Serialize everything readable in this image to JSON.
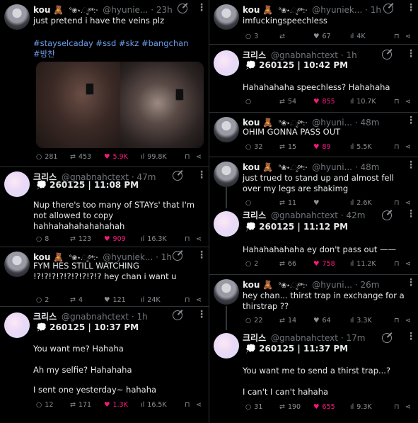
{
  "left_column": {
    "tweets": [
      {
        "author": {
          "name": "kou",
          "emoji": "🧸",
          "decoration": "°❀⋆.ೃ࿔*:･",
          "handle": "@hyunie...",
          "time": "· 23h"
        },
        "text": "just pretend i have the veins plz",
        "hashtags": "#stayselcaday #ssd #skz #bangchan #방찬",
        "stats": {
          "replies": "281",
          "reposts": "453",
          "likes": "5.9K",
          "views": "99.8K"
        }
      },
      {
        "author": {
          "name": "크리스",
          "handle": "@gnabnahctext",
          "time": "· 47m"
        },
        "stamp": "💭 260125 | 11:08 PM",
        "text": "Nup there's too many of STAYs' that I'm not allowed to copy hahhahahahahahahah",
        "stats": {
          "replies": "8",
          "reposts": "123",
          "likes": "909",
          "views": "16.3K"
        }
      },
      {
        "author": {
          "name": "kou",
          "emoji": "🧸",
          "decoration": "°❀⋆.ೃ࿔*:･",
          "handle": "@hyuniek...",
          "time": "· 1h"
        },
        "text": "FYM HES STILL WATCHING !?!?!?!?!?!?!?!?!? hey chan i want u",
        "stats": {
          "replies": "2",
          "reposts": "4",
          "likes": "121",
          "views": "24K"
        }
      },
      {
        "author": {
          "name": "크리스",
          "handle": "@gnabnahctext",
          "time": "· 1h"
        },
        "stamp": "💭 260125 | 10:37 PM",
        "lines": [
          "You want me? Hahaha",
          "Ah my selfie? Hahahaha",
          "I sent one yesterday~ hahaha"
        ],
        "stats": {
          "replies": "12",
          "reposts": "171",
          "likes": "1.3K",
          "views": "16.5K"
        }
      }
    ]
  },
  "right_column": {
    "tweets": [
      {
        "author": {
          "name": "kou",
          "emoji": "🧸",
          "decoration": "°❀⋆.ೃ࿔*:･",
          "handle": "@hyuniek...",
          "time": "· 1h"
        },
        "text": "imfuckingspeechless",
        "stats": {
          "replies": "3",
          "reposts": "",
          "likes": "67",
          "views": "4K"
        }
      },
      {
        "author": {
          "name": "크리스",
          "handle": "@gnabnahctext",
          "time": "· 1h"
        },
        "stamp": "💭 260125 | 10:42 PM",
        "text": "Hahahahaha speechless? Hahahaha",
        "stats": {
          "replies": "",
          "reposts": "54",
          "likes": "855",
          "views": "10.7K"
        }
      },
      {
        "author": {
          "name": "kou",
          "emoji": "🧸",
          "decoration": "°❀⋆.ೃ࿔*:･",
          "handle": "@hyuni...",
          "time": "· 48m"
        },
        "text": "OHIM GONNA PASS OUT",
        "stats": {
          "replies": "32",
          "reposts": "15",
          "likes": "89",
          "views": "5.5K"
        }
      },
      {
        "author": {
          "name": "kou",
          "emoji": "🧸",
          "decoration": "°❀⋆.ೃ࿔*:･",
          "handle": "@hyuni...",
          "time": "· 48m"
        },
        "text": "just trued to stand up and almost fell over my legs are shakimg",
        "stats": {
          "replies": "",
          "reposts": "11",
          "likes": "",
          "views": "2.6K"
        }
      },
      {
        "author": {
          "name": "크리스",
          "handle": "@gnabnahctext",
          "time": "· 42m"
        },
        "stamp": "💭 260125 | 11:12 PM",
        "text": "Hahahahahaha ey don't pass out ——",
        "stats": {
          "replies": "2",
          "reposts": "66",
          "likes": "758",
          "views": "11.2K"
        }
      },
      {
        "author": {
          "name": "kou",
          "emoji": "🧸",
          "decoration": "°❀⋆.ೃ࿔*:･",
          "handle": "@hyuni...",
          "time": "· 26m"
        },
        "text": "hey chan... thirst trap in exchange for a thirstrap ??",
        "stats": {
          "replies": "22",
          "reposts": "14",
          "likes": "64",
          "views": "3.3K"
        }
      },
      {
        "author": {
          "name": "크리스",
          "handle": "@gnabnahctext",
          "time": "· 17m"
        },
        "stamp": "💭 260125 | 11:37 PM",
        "lines": [
          "You want me to send a thirst trap...?",
          "I can't I can't hahaha"
        ],
        "stats": {
          "replies": "31",
          "reposts": "190",
          "likes": "655",
          "views": "9.3K"
        }
      }
    ]
  },
  "icons": {
    "reply": "○",
    "repost": "⇄",
    "like": "♥",
    "views": "ıl",
    "bookmark": "⊓",
    "share": "⋖",
    "more": "⋮"
  },
  "colors": {
    "background": "#000000",
    "text": "#e7e9ea",
    "muted": "#71767b",
    "hashtag": "#6d9eeb",
    "like": "#f91880",
    "divider": "#2f3336"
  }
}
